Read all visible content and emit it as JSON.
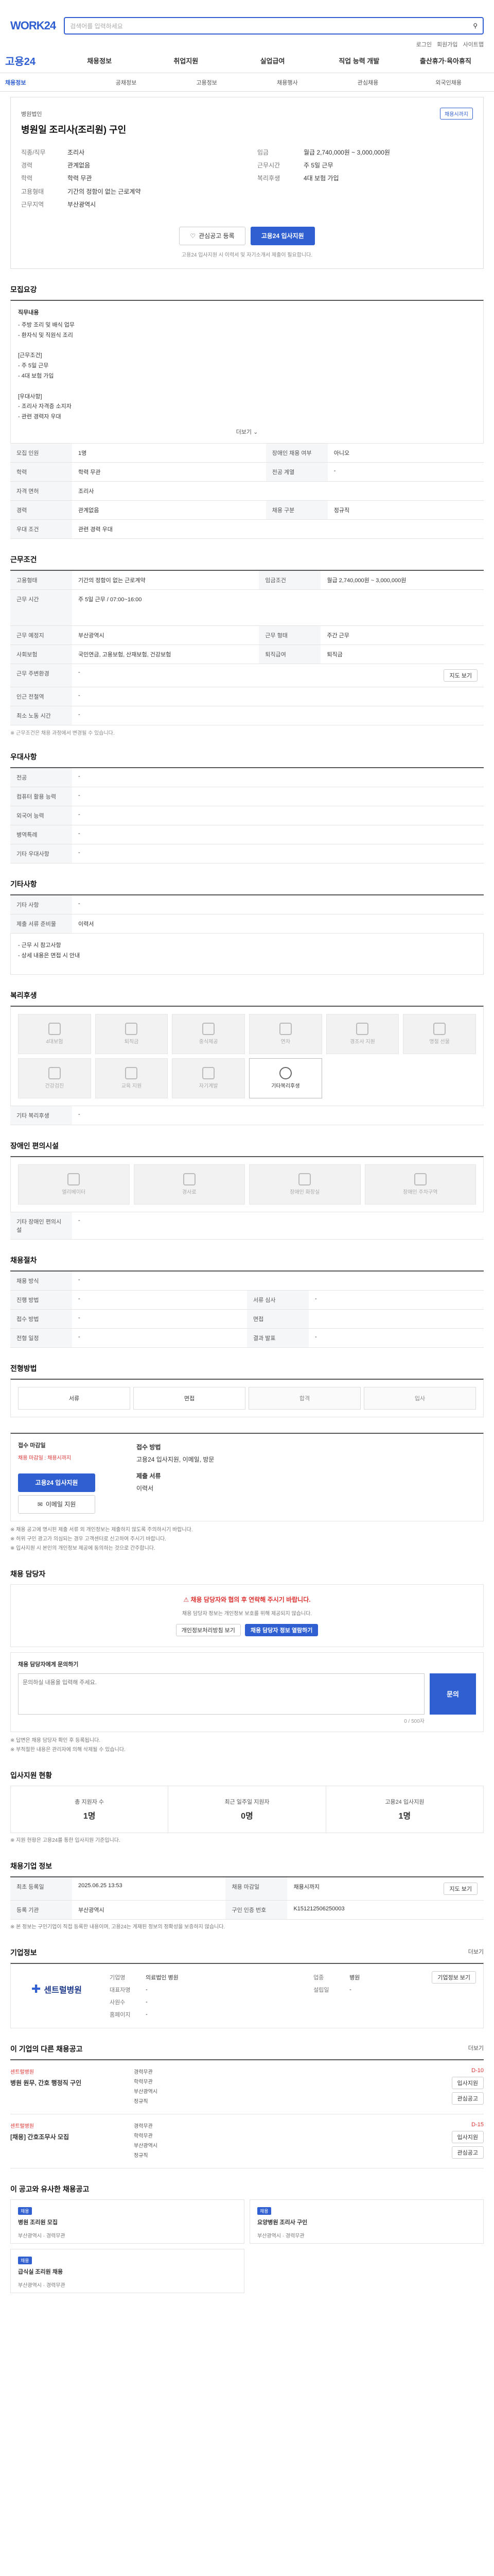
{
  "header": {
    "logo": "WORK24",
    "search_placeholder": "검색어를 입력하세요",
    "util": [
      "로그인",
      "회원가입",
      "사이트맵"
    ]
  },
  "gnb": {
    "brand": "고용24",
    "menu": [
      "채용정보",
      "취업지원",
      "실업급여",
      "직업 능력 개발",
      "출산휴가·육아휴직"
    ]
  },
  "subnav": [
    "채용정보",
    "공채정보",
    "고용정보",
    "채용행사",
    "관심채용",
    "외국인채용"
  ],
  "job": {
    "company": "병원법인",
    "title": "병원일 조리사(조리원) 구인",
    "badge": "채용시까지",
    "left": [
      {
        "k": "직종/직무",
        "v": "조리사"
      },
      {
        "k": "경력",
        "v": "관계없음"
      },
      {
        "k": "학력",
        "v": "학력 무관"
      },
      {
        "k": "고용형태",
        "v": "기간의 정함이 없는 근로계약"
      },
      {
        "k": "근무지역",
        "v": "부산광역시"
      }
    ],
    "right": [
      {
        "k": "임금",
        "v": "월급 2,740,000원 ~ 3,000,000원"
      },
      {
        "k": "근무시간",
        "v": "주 5일 근무"
      },
      {
        "k": "복리후생",
        "v": "4대 보험 가입"
      }
    ],
    "btn_scrap": "관심공고 등록",
    "btn_apply": "고용24 입사지원",
    "apply_note": "고용24 입사지원 시 이력서 및 자기소개서 제출이 필요합니다."
  },
  "recruit": {
    "h": "모집요강",
    "duty_title": "직무내용",
    "duty": "- 주방 조리 및 배식 업무\n- 환자식 및 직원식 조리\n\n[근무조건]\n- 주 5일 근무\n- 4대 보험 가입\n\n[우대사항]\n- 조리사 자격증 소지자\n- 관련 경력자 우대",
    "more": "더보기",
    "rows": [
      {
        "k": "모집 인원",
        "v": "1명",
        "k2": "장애인 채용 여부",
        "v2": "아니오"
      },
      {
        "k": "학력",
        "v": "학력 무관",
        "k2": "전공 계열",
        "v2": "-"
      },
      {
        "k": "자격 면허",
        "v": "조리사",
        "k2": "",
        "v2": ""
      },
      {
        "k": "경력",
        "v": "관계없음",
        "k2": "채용 구분",
        "v2": "정규직"
      },
      {
        "k": "우대 조건",
        "v": "관련 경력 우대",
        "k2": "",
        "v2": ""
      }
    ]
  },
  "work": {
    "h": "근무조건",
    "rows": [
      {
        "k": "고용형태",
        "v": "기간의 정함이 없는 근로계약",
        "k2": "임금조건",
        "v2": "월급 2,740,000원 ~ 3,000,000원"
      },
      {
        "k": "근무 시간",
        "v": "주 5일 근무 / 07:00~16:00",
        "k2": "",
        "v2": ""
      },
      {
        "k": "근무 예정지",
        "v": "부산광역시",
        "k2": "근무 형태",
        "v2": "주간 근무"
      },
      {
        "k": "사회보험",
        "v": "국민연금, 고용보험, 산재보험, 건강보험",
        "k2": "퇴직급여",
        "v2": "퇴직금"
      },
      {
        "k": "근무 주변환경",
        "v": "-",
        "k2": "",
        "v2": ""
      },
      {
        "k": "인근 전철역",
        "v": "-",
        "k2": "",
        "v2": ""
      },
      {
        "k": "최소 노동 시간",
        "v": "-",
        "k2": "",
        "v2": ""
      }
    ],
    "map_btn": "지도 보기",
    "note": "※ 근무조건은 채용 과정에서 변경될 수 있습니다."
  },
  "welfare": {
    "h": "우대사항",
    "rows": [
      {
        "k": "전공",
        "v": "-"
      },
      {
        "k": "컴퓨터 활용 능력",
        "v": "-"
      },
      {
        "k": "외국어 능력",
        "v": "-"
      },
      {
        "k": "병역특례",
        "v": "-"
      },
      {
        "k": "기타 우대사항",
        "v": "-"
      }
    ]
  },
  "etc": {
    "h": "기타사항",
    "rows": [
      {
        "k": "기타 사항",
        "v": "-"
      },
      {
        "k": "제출 서류 준비물",
        "v": "이력서"
      }
    ],
    "box": "- 근무 시 참고사항\n- 상세 내용은 면접 시 안내"
  },
  "benefits": {
    "h": "복리후생",
    "items": [
      "4대보험",
      "퇴직금",
      "중식제공",
      "연차",
      "경조사 지원",
      "명절 선물",
      "건강검진",
      "교육 지원",
      "자기계발",
      "기타복리후생"
    ],
    "active_index": 9,
    "etc_label": "기타 복리후생",
    "etc_value": "-"
  },
  "disabled": {
    "h": "장애인 편의시설",
    "items": [
      "엘리베이터",
      "경사로",
      "장애인 화장실",
      "장애인 주차구역"
    ],
    "label": "기타 장애인 편의시설",
    "value": "-"
  },
  "detail": {
    "h": "채용절차",
    "rows": [
      {
        "k": "채용 방식",
        "v": "-",
        "k2": "",
        "v2": ""
      },
      {
        "k": "진행 방법",
        "v": "-",
        "k2": "서류 심사",
        "v2": "-"
      },
      {
        "k": "접수 방법",
        "v": "-",
        "k2": "면접",
        "v2": ""
      },
      {
        "k": "전형 일정",
        "v": "-",
        "k2": "결과 발표",
        "v2": "-"
      }
    ]
  },
  "process": {
    "h": "전형방법",
    "steps": [
      "서류",
      "면접",
      "합격",
      "입사"
    ],
    "active": [
      0,
      1
    ]
  },
  "apply": {
    "h": "접수 마감일",
    "deadline_label": "채용 마감일",
    "deadline": "채용시까지",
    "apply_method": "접수 방법",
    "apply_method_value": "고용24 입사지원, 이메일, 방문",
    "doc_label": "제출 서류",
    "doc_value": "이력서",
    "btn_apply": "고용24 입사지원",
    "btn_email": "이메일 지원",
    "notes": [
      "※ 채용 공고에 명시된 제출 서류 외 개인정보는 제출하지 않도록 주의하시기 바랍니다.",
      "※ 허위 구인 광고가 의심되는 경우 고객센터로 신고하여 주시기 바랍니다.",
      "※ 입사지원 시 본인의 개인정보 제공에 동의하는 것으로 간주합니다."
    ]
  },
  "qa": {
    "h": "채용 담당자",
    "alert": "채용 담당자와 협의 후 연락해 주시기 바랍니다.",
    "alert_sub": "채용 담당자 정보는 개인정보 보호를 위해 제공되지 않습니다.",
    "btn1": "개인정보처리방침 보기",
    "btn2": "채용 담당자 정보 열람하기",
    "input_label": "채용 담당자에게 문의하기",
    "placeholder": "문의하실 내용을 입력해 주세요.",
    "counter": "0 / 500자",
    "submit": "문의",
    "bullets": [
      "※ 답변은 채용 담당자 확인 후 등록됩니다.",
      "※ 부적절한 내용은 관리자에 의해 삭제될 수 있습니다."
    ]
  },
  "stats": {
    "h": "입사지원 현황",
    "items": [
      {
        "k": "총 지원자 수",
        "v": "1명"
      },
      {
        "k": "최근 일주일 지원자",
        "v": "0명"
      },
      {
        "k": "고용24 입사지원",
        "v": "1명"
      }
    ],
    "note": "※ 지원 현황은 고용24를 통한 입사지원 기준입니다."
  },
  "info": {
    "h": "채용기업 정보",
    "rows": [
      {
        "k": "최초 등록일",
        "v": "2025.06.25 13:53",
        "k2": "채용 마감일",
        "v2": "채용시까지"
      },
      {
        "k": "등록 기관",
        "v": "부산광역시",
        "k2": "구인 인증 번호",
        "v2": "K151212506250003"
      }
    ],
    "btn": "지도 보기",
    "note": "※ 본 정보는 구인기업이 직접 등록한 내용이며, 고용24는 게재된 정보의 정확성을 보증하지 않습니다."
  },
  "company": {
    "h": "기업정보",
    "more": "더보기",
    "name": "센트럴병원",
    "rows": [
      {
        "k": "기업명",
        "v": "의료법인 병원",
        "k2": "업종",
        "v2": "병원"
      },
      {
        "k": "대표자명",
        "v": "-",
        "k2": "설립일",
        "v2": "-"
      },
      {
        "k": "사원수",
        "v": "-",
        "k2": "",
        "v2": ""
      },
      {
        "k": "홈페이지",
        "v": "-",
        "k2": "",
        "v2": ""
      }
    ],
    "btn": "기업정보 보기"
  },
  "other": {
    "h": "이 기업의 다른 채용공고",
    "link": "더보기",
    "jobs": [
      {
        "co": "센트럴병원",
        "title": "병원 원무, 간호 행정직 구인",
        "d": [
          "경력무관",
          "학력무관",
          "부산광역시",
          "정규직"
        ],
        "dday": "D-10",
        "b1": "입사지원",
        "b2": "관심공고"
      },
      {
        "co": "센트럴병원",
        "title": "[채용] 간호조무사 모집",
        "d": [
          "경력무관",
          "학력무관",
          "부산광역시",
          "정규직"
        ],
        "dday": "D-15",
        "b1": "입사지원",
        "b2": "관심공고"
      }
    ]
  },
  "similar": {
    "h": "이 공고와 유사한 채용공고",
    "cards": [
      {
        "tag": "채용",
        "t": "병원 조리원 모집",
        "m": "부산광역시 · 경력무관"
      },
      {
        "tag": "채용",
        "t": "요양병원 조리사 구인",
        "m": "부산광역시 · 경력무관"
      },
      {
        "tag": "채용",
        "t": "급식실 조리원 채용",
        "m": "부산광역시 · 경력무관"
      }
    ]
  },
  "colors": {
    "primary": "#2f5fd1",
    "alert": "#dd3333"
  }
}
